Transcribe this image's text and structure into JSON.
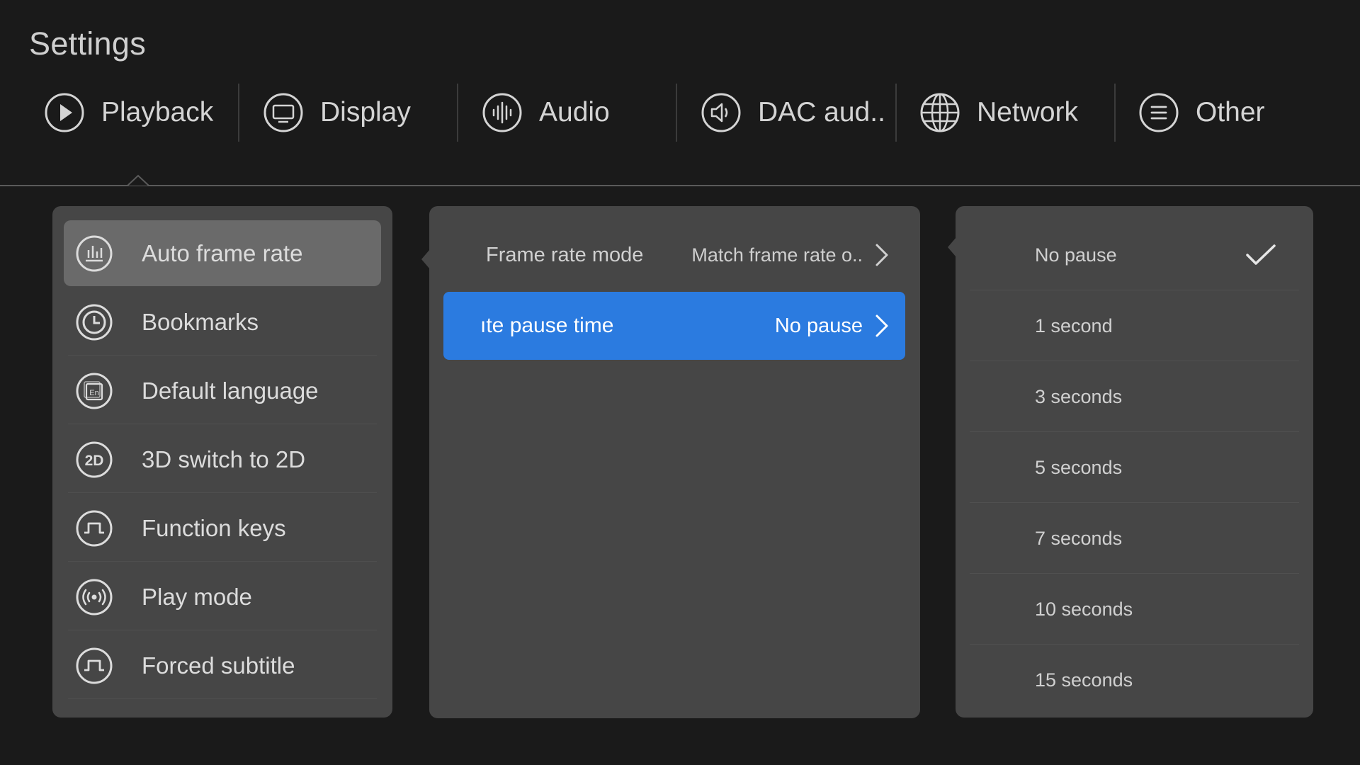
{
  "title": "Settings",
  "tabs": [
    {
      "label": "Playback",
      "icon": "play-circle-icon"
    },
    {
      "label": "Display",
      "icon": "monitor-icon"
    },
    {
      "label": "Audio",
      "icon": "audio-waveform-icon"
    },
    {
      "label": "DAC aud..",
      "icon": "speaker-icon"
    },
    {
      "label": "Network",
      "icon": "globe-icon"
    },
    {
      "label": "Other",
      "icon": "menu-lines-icon"
    }
  ],
  "selected_tab": "Playback",
  "left_menu": {
    "selected": "Auto frame rate",
    "items": [
      {
        "label": "Auto frame rate",
        "icon": "bar-chart-icon"
      },
      {
        "label": "Bookmarks",
        "icon": "clock-icon"
      },
      {
        "label": "Default language",
        "icon": "language-icon"
      },
      {
        "label": "3D switch to 2D",
        "icon": "2d-icon"
      },
      {
        "label": "Function keys",
        "icon": "pulse-icon"
      },
      {
        "label": "Play mode",
        "icon": "broadcast-icon"
      },
      {
        "label": "Forced subtitle",
        "icon": "pulse-icon"
      }
    ]
  },
  "middle": {
    "rows": [
      {
        "label": "Frame rate mode",
        "value": "Match frame rate o..",
        "active": false
      },
      {
        "label": "ıte pause time",
        "value": "No pause",
        "active": true
      }
    ]
  },
  "options": {
    "selected": "No pause",
    "items": [
      "No pause",
      "1 second",
      "3 seconds",
      "5 seconds",
      "7 seconds",
      "10 seconds",
      "15 seconds"
    ]
  },
  "colors": {
    "background": "#1a1a1a",
    "panel": "#464646",
    "selected_item": "#6a6a6a",
    "accent": "#2b7be0",
    "text": "#d8d8d8"
  }
}
